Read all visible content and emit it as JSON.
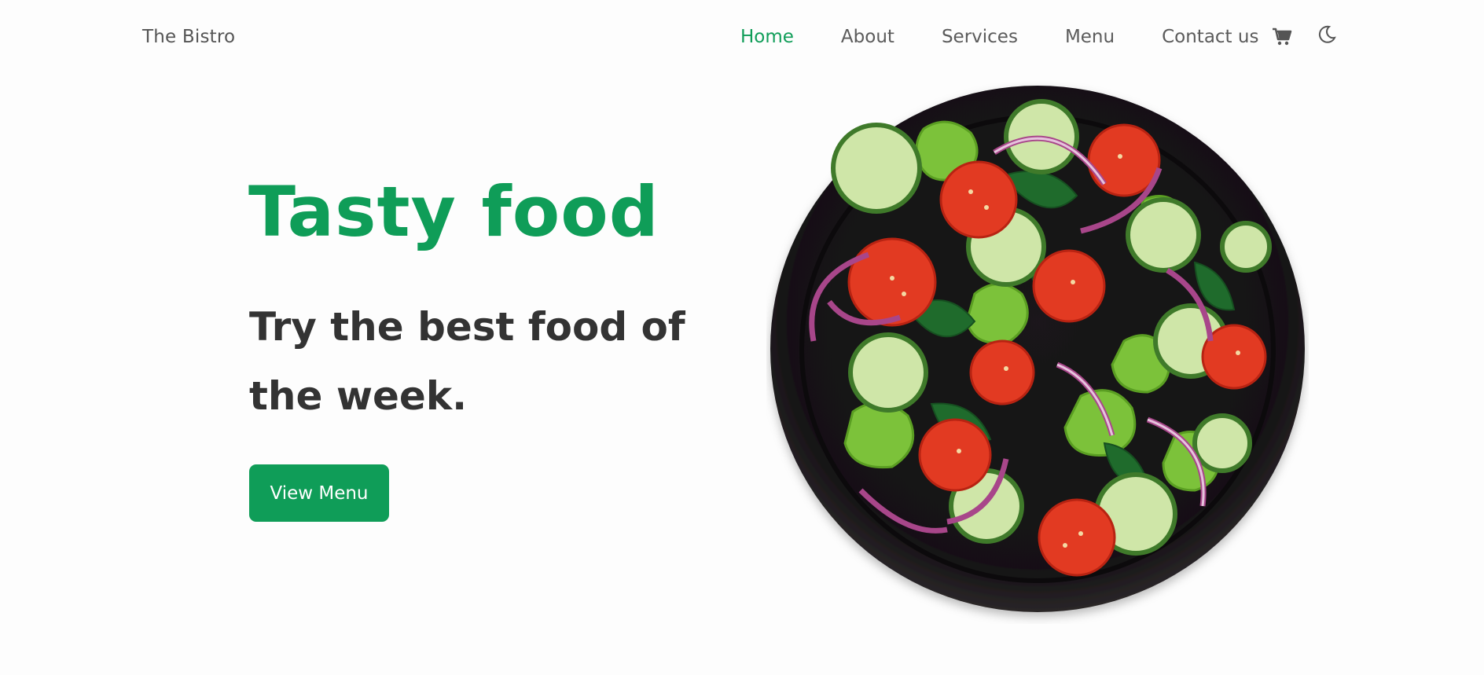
{
  "header": {
    "brand": "The Bistro",
    "nav": [
      {
        "label": "Home",
        "active": true
      },
      {
        "label": "About",
        "active": false
      },
      {
        "label": "Services",
        "active": false
      },
      {
        "label": "Menu",
        "active": false
      },
      {
        "label": "Contact us",
        "active": false
      }
    ],
    "icons": [
      "cart-icon",
      "moon-icon"
    ]
  },
  "hero": {
    "title": "Tasty food",
    "subtitle": "Try the best food of the week.",
    "button_label": "View Menu",
    "image": "salad-bowl"
  },
  "colors": {
    "accent": "#0f9d58",
    "text_dark": "#333333",
    "nav_text": "#5b5b5b",
    "background": "#fdfdfd"
  }
}
